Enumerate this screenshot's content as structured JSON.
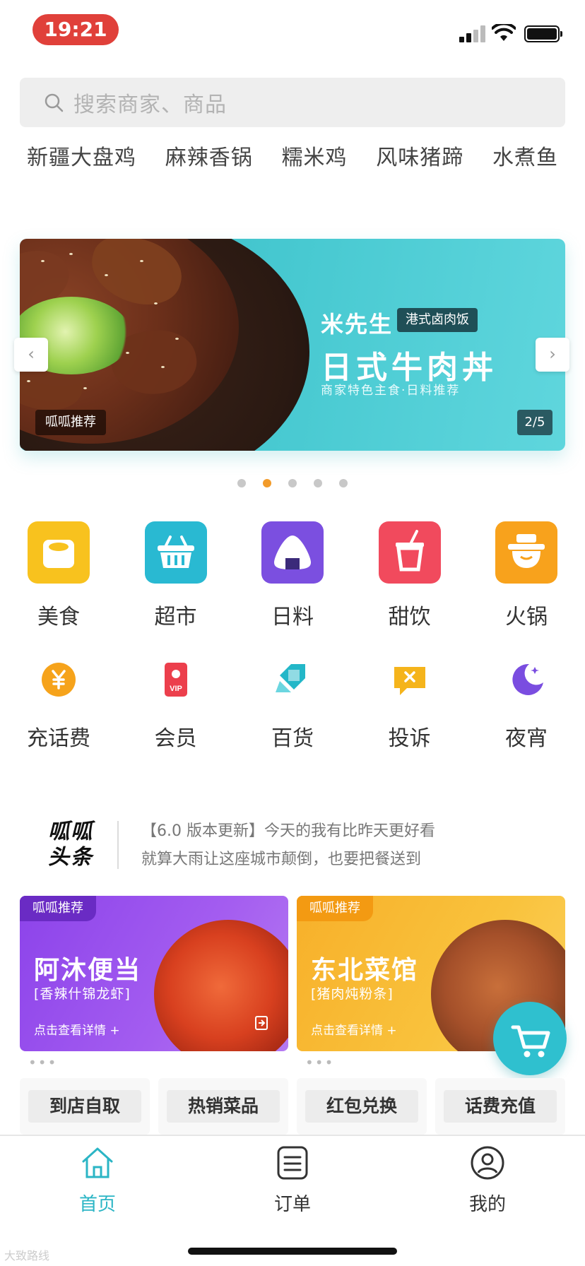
{
  "status_bar": {
    "time": "19:21"
  },
  "search": {
    "placeholder": "搜索商家、商品"
  },
  "hot_tags": [
    "新疆大盘鸡",
    "麻辣香锅",
    "糯米鸡",
    "风味猪蹄",
    "水煮鱼"
  ],
  "banner": {
    "tag": "呱呱推荐",
    "brand": "米先生",
    "badge": "港式卤肉饭",
    "headline": "日式牛肉丼",
    "subline": "商家特色主食·日料推荐",
    "page": "2/5",
    "prev": "‹",
    "next": "›",
    "dot_count": 5,
    "active_dot": 2
  },
  "categories": [
    {
      "label": "美食",
      "icon": "food-bowl-icon",
      "color": "#f8c21e"
    },
    {
      "label": "超市",
      "icon": "shopping-basket-icon",
      "color": "#29b9d2"
    },
    {
      "label": "日料",
      "icon": "onigiri-icon",
      "color": "#7b4fe0"
    },
    {
      "label": "甜饮",
      "icon": "drink-cup-icon",
      "color": "#f14a5d"
    },
    {
      "label": "火锅",
      "icon": "hotpot-icon",
      "color": "#f8a21c"
    }
  ],
  "services": [
    {
      "label": "充话费",
      "icon": "yuan-coin-icon",
      "color": "#f6a31b"
    },
    {
      "label": "会员",
      "icon": "vip-card-icon",
      "color": "#ec3f4c",
      "badge_text": "VIP"
    },
    {
      "label": "百货",
      "icon": "department-store-icon",
      "color": "#23b7c8"
    },
    {
      "label": "投诉",
      "icon": "complaint-icon",
      "color": "#f5b41b"
    },
    {
      "label": "夜宵",
      "icon": "moon-icon",
      "color": "#7a4de0"
    }
  ],
  "news": {
    "logo_line1": "呱呱",
    "logo_line2": "头条",
    "line1": "【6.0 版本更新】今天的我有比昨天更好看",
    "line2": "就算大雨让这座城市颠倒，也要把餐送到"
  },
  "promos": [
    {
      "tag": "呱呱推荐",
      "title": "阿沐便当",
      "subtitle": "[香辣什锦龙虾]",
      "link": "点击查看详情 +",
      "color": "#8b45e8"
    },
    {
      "tag": "呱呱推荐",
      "title": "东北菜馆",
      "subtitle": "[猪肉炖粉条]",
      "link": "点击查看详情 +",
      "color": "#f7b42a"
    }
  ],
  "promo_dots": "•••",
  "quick_links": [
    "到店自取",
    "热销菜品",
    "红包兑换",
    "话费充值"
  ],
  "tabs": [
    {
      "label": "首页",
      "icon": "home-icon",
      "active": true
    },
    {
      "label": "订单",
      "icon": "order-list-icon",
      "active": false
    },
    {
      "label": "我的",
      "icon": "profile-icon",
      "active": false
    }
  ],
  "watermark": "大致路线",
  "colors": {
    "accent": "#2bb5c5",
    "time_pill": "#e0403a",
    "active_dot": "#f29b2a"
  }
}
